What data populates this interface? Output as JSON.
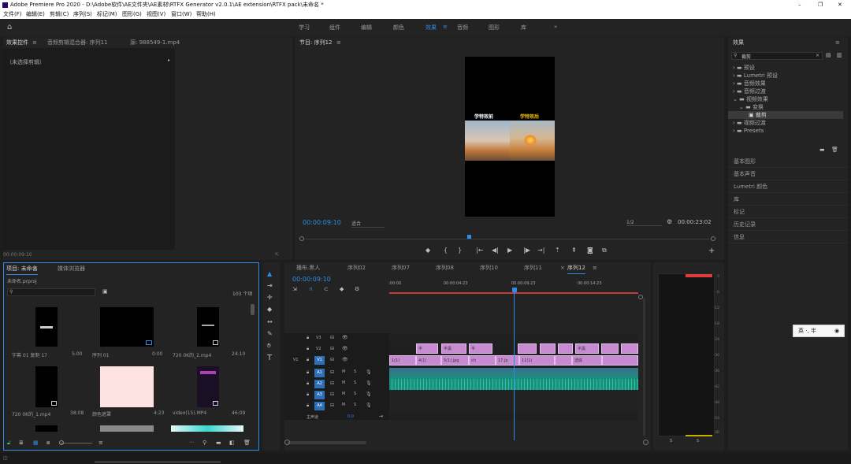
{
  "window": {
    "title": "Adobe Premiere Pro 2020 - D:\\Adobe软件\\AE文件夹\\AE素材\\RTFX Generator v2.0.1\\AE extension\\RTFX pack\\未命名 *",
    "minimize": "–",
    "maximize": "❐",
    "close": "✕"
  },
  "menu": [
    "文件(F)",
    "编辑(E)",
    "剪辑(C)",
    "序列(S)",
    "标记(M)",
    "图形(G)",
    "视图(V)",
    "窗口(W)",
    "帮助(H)"
  ],
  "workspaces": {
    "items": [
      "学习",
      "组件",
      "编辑",
      "颜色",
      "效果",
      "音频",
      "图形",
      "库"
    ],
    "active": "效果",
    "more": "»"
  },
  "effect_controls": {
    "tabs": [
      "效果控件",
      "音频剪辑混合器: 序列11",
      "源: 988549-1.mp4"
    ],
    "active_tab": "效果控件",
    "no_clip": "（未选择剪辑）",
    "timecode": "00:00:09:10"
  },
  "program_monitor": {
    "title": "节目: 序列12",
    "timecode": "00:00:09:10",
    "fit": "适合",
    "quality": "1/2",
    "duration": "00:00:23:02",
    "frame": {
      "label_before": "学特效前",
      "label_after": "学特效后"
    }
  },
  "project": {
    "tabs": [
      "项目: 未命名",
      "媒体浏览器"
    ],
    "filename": "未命名.prproj",
    "count": "103 个项",
    "items": [
      {
        "name": "字幕 01 复制 17",
        "dur": "5:00"
      },
      {
        "name": "序列 01",
        "dur": "0:00"
      },
      {
        "name": "720 0K的_2.mp4",
        "dur": "24:10"
      },
      {
        "name": "720 0K的_1.mp4",
        "dur": "38:08"
      },
      {
        "name": "颜色遮罩",
        "dur": "4:23"
      },
      {
        "name": "video(15).MP4",
        "dur": "46:09"
      }
    ]
  },
  "timeline": {
    "tabs": [
      "播布.黑人",
      "序列02",
      "序列07",
      "序列08",
      "序列10",
      "序列11",
      "序列12"
    ],
    "active_tab": "序列12",
    "timecode": "00:00:09:10",
    "ruler": [
      ":00:00",
      "00:00:04:23",
      "00:00:09:23",
      "00:00:14:23"
    ],
    "tracks_video": [
      "V3",
      "V2",
      "V1"
    ],
    "tracks_audio": [
      "A1",
      "A2",
      "A3",
      "A4"
    ],
    "master": "主声道",
    "master_value": "0.0",
    "v1_source": "V1",
    "audio_labels": [
      "M",
      "S"
    ],
    "v2_clips": [
      {
        "label": "半"
      },
      {
        "label": "半黑"
      },
      {
        "label": "半"
      },
      {
        "label": ""
      },
      {
        "label": ""
      },
      {
        "label": ""
      },
      {
        "label": "半黑"
      },
      {
        "label": ""
      },
      {
        "label": ""
      }
    ],
    "v1_clips": [
      {
        "label": "1(1)"
      },
      {
        "label": "4(1)"
      },
      {
        "label": "5(1).jpg"
      },
      {
        "label": "ch"
      },
      {
        "label": "17.jp"
      },
      {
        "label": "11(1)"
      },
      {
        "label": ""
      },
      {
        "label": "透底"
      },
      {
        "label": ""
      }
    ]
  },
  "effects": {
    "title": "效果",
    "search": "裁剪",
    "tree": [
      {
        "label": "预设",
        "level": 0
      },
      {
        "label": "Lumetri 预设",
        "level": 0
      },
      {
        "label": "音频效果",
        "level": 0
      },
      {
        "label": "音频过渡",
        "level": 0
      },
      {
        "label": "视频效果",
        "level": 0
      },
      {
        "label": "变换",
        "level": 1
      },
      {
        "label": "裁剪",
        "level": 2
      },
      {
        "label": "视频过渡",
        "level": 0
      },
      {
        "label": "Presets",
        "level": 0
      }
    ],
    "panels": [
      "基本图形",
      "基本声音",
      "Lumetri 颜色",
      "库",
      "标记",
      "历史记录",
      "信息"
    ]
  },
  "audio_meter": {
    "ticks": [
      "0",
      "-6",
      "-12",
      "-18",
      "-24",
      "-30",
      "-36",
      "-42",
      "-48",
      "-54",
      "dB"
    ],
    "channels": [
      "S",
      "S"
    ]
  },
  "ime": {
    "text": "英 ·, 半"
  },
  "colors": {
    "accent": "#2d8ceb",
    "clip_pink": "#d58cd8",
    "audio_teal": "#1b8f7a",
    "playhead": "#2d8ceb",
    "meter_red": "#e23b3b"
  }
}
